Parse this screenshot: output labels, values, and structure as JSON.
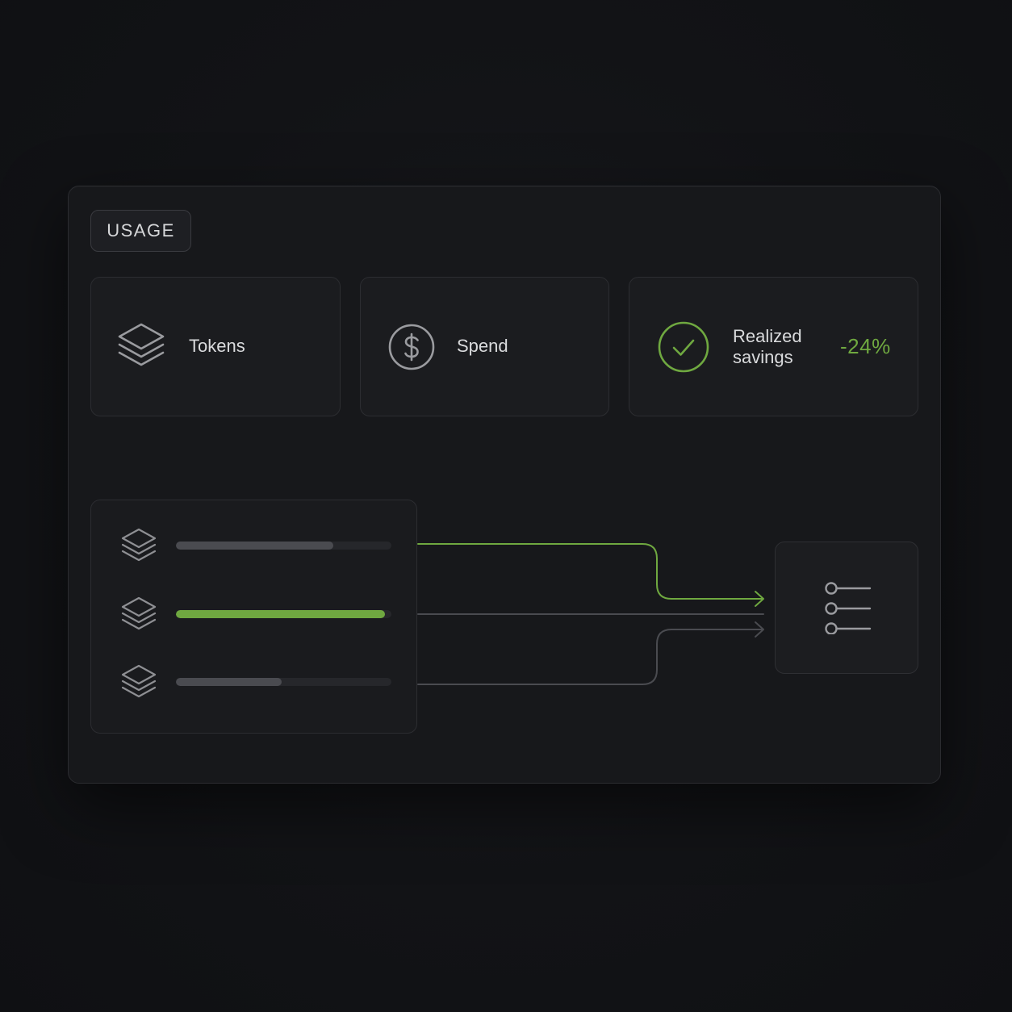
{
  "panel": {
    "tag_label": "USAGE"
  },
  "metrics": {
    "tokens": {
      "label": "Tokens",
      "icon": "layers-icon"
    },
    "spend": {
      "label": "Spend",
      "icon": "dollar-circle-icon"
    },
    "savings": {
      "label": "Realized savings",
      "value": "-24%",
      "icon": "check-circle-icon",
      "accent": "#6fa840"
    }
  },
  "sources": [
    {
      "icon": "layers-icon",
      "fill": 0.73,
      "active": false
    },
    {
      "icon": "layers-icon",
      "fill": 0.97,
      "active": true
    },
    {
      "icon": "layers-icon",
      "fill": 0.49,
      "active": false
    }
  ],
  "target": {
    "icon": "filter-list-icon"
  },
  "colors": {
    "accent": "#6fa840",
    "neutral_line": "#4a4b50",
    "background": "#121316"
  }
}
